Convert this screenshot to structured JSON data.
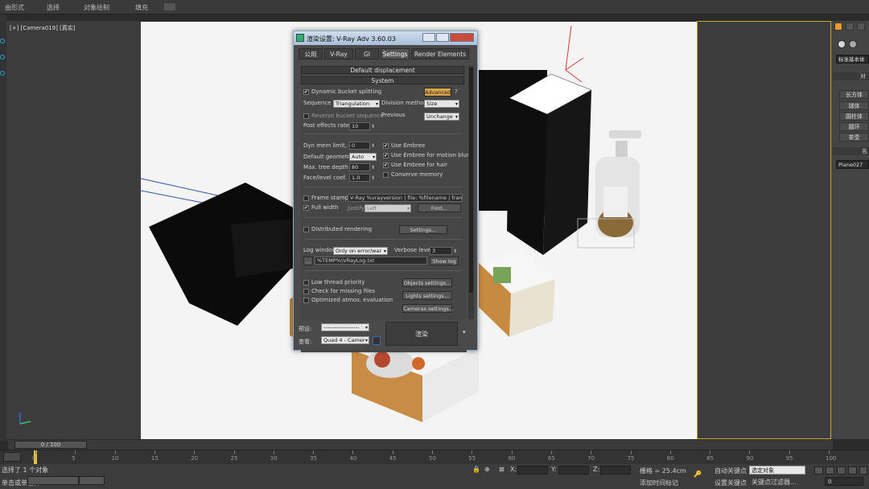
{
  "menu": [
    "由形式",
    "选择",
    "对象绘制",
    "填充"
  ],
  "viewport": {
    "label": "[+] [Camera019] [真实]"
  },
  "scene": {
    "colors": {
      "background": "#f4f4f4",
      "dark": "#0d0d0d",
      "axis_red": "#d23c3c",
      "line_blue": "#3050a0"
    }
  },
  "command_panel": {
    "dropdown": "标准基本体",
    "section1": "对",
    "buttons": [
      "长方体",
      "球体",
      "圆柱体",
      "圆环",
      "茶壶"
    ],
    "section2": "名",
    "name_field": "Plane027"
  },
  "dialog": {
    "title": "渲染设置: V-Ray Adv 3.60.03",
    "tabs": [
      "公用",
      "V-Ray",
      "GI",
      "Settings",
      "Render Elements"
    ],
    "active_tab": "Settings",
    "rollouts": {
      "default_displacement": "Default displacement",
      "system": "System"
    },
    "bucket": {
      "dynamic_label": "Dynamic bucket splitting",
      "advanced": "Advanced",
      "help": "?",
      "sequence_label": "Sequence",
      "sequence_value": "Triangulation",
      "division_label": "Division method",
      "division_value": "Size",
      "reverse_label": "Reverse bucket sequence",
      "previous_label": "Previous",
      "previous_value": "Unchange",
      "post_effects_label": "Post effects rate",
      "post_effects_value": "10"
    },
    "memory": {
      "dyn_mem_label": "Dyn mem limit, mb",
      "dyn_mem_value": "0",
      "geometry_label": "Default geometry",
      "geometry_value": "Auto",
      "tree_depth_label": "Max. tree depth",
      "tree_depth_value": "80",
      "face_coef_label": "Face/level coef.",
      "face_coef_value": "1.0",
      "use_embree": "Use Embree",
      "embree_blur": "Use Embree for motion blur",
      "embree_hair": "Use Embree for hair",
      "conserve": "Conserve memory"
    },
    "stamp": {
      "frame_stamp_label": "Frame stamp",
      "frame_stamp_text": "V-Ray %vrayversion | file: %filename | fram",
      "full_width_label": "Full width",
      "justify_label": "Justify",
      "justify_value": "Left",
      "font_button": "Font..."
    },
    "distributed": {
      "label": "Distributed rendering",
      "settings_button": "Settings..."
    },
    "log": {
      "window_label": "Log window",
      "window_value": "Only on error/war",
      "verbose_label": "Verbose level",
      "verbose_value": "3",
      "browse": "...",
      "path": "%TEMP%\\VRayLog.txt",
      "show_button": "Show log"
    },
    "misc": {
      "low_priority": "Low thread priority",
      "check_missing": "Check for missing files",
      "optimized": "Optimized atmos. evaluation",
      "objects_button": "Objects settings...",
      "lights_button": "Lights settings...",
      "cameras_button": "Cameras settings..."
    },
    "bottom": {
      "preset_label": "预设:",
      "preset_value": "-------------------",
      "view_label": "查看:",
      "view_value": "Quad 4 - Camer",
      "render_button": "渲染"
    }
  },
  "timeline": {
    "slider": "0 / 100",
    "ticks": [
      "0",
      "5",
      "10",
      "15",
      "20",
      "25",
      "30",
      "35",
      "40",
      "45",
      "50",
      "55",
      "60",
      "65",
      "70",
      "75",
      "80",
      "85",
      "90",
      "95",
      "100"
    ]
  },
  "status": {
    "selection_text": "选择了 1 个对象",
    "prompt_text": "单击或单击并",
    "x_label": "X:",
    "y_label": "Y:",
    "z_label": "Z:",
    "grid_text": "栅格 = 25.4cm",
    "add_tag": "添加时间标记",
    "auto_key": "自动关键点",
    "set_key": "设置关键点",
    "selected_dropdown": "选定对象",
    "key_filter": "关键点过滤器...",
    "frame_value": "0"
  }
}
